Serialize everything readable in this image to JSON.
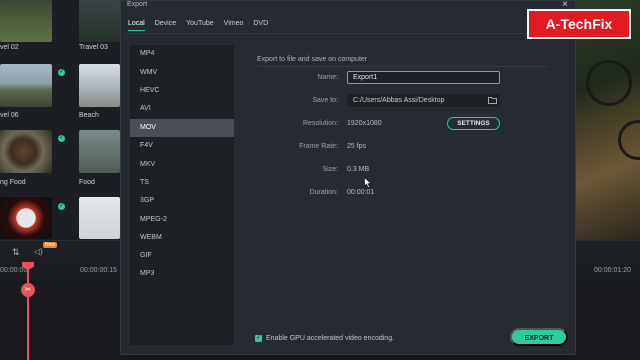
{
  "dialog": {
    "title": "Export",
    "close_glyph": "×",
    "tabs": [
      {
        "label": "Local",
        "active": true
      },
      {
        "label": "Device",
        "active": false
      },
      {
        "label": "YouTube",
        "active": false
      },
      {
        "label": "Vimeo",
        "active": false
      },
      {
        "label": "DVD",
        "active": false
      }
    ],
    "formats": [
      {
        "label": "MP4",
        "selected": false
      },
      {
        "label": "WMV",
        "selected": false
      },
      {
        "label": "HEVC",
        "selected": false
      },
      {
        "label": "AVI",
        "selected": false
      },
      {
        "label": "MOV",
        "selected": true
      },
      {
        "label": "F4V",
        "selected": false
      },
      {
        "label": "MKV",
        "selected": false
      },
      {
        "label": "TS",
        "selected": false
      },
      {
        "label": "3GP",
        "selected": false
      },
      {
        "label": "MPEG-2",
        "selected": false
      },
      {
        "label": "WEBM",
        "selected": false
      },
      {
        "label": "GIF",
        "selected": false
      },
      {
        "label": "MP3",
        "selected": false
      }
    ],
    "section_title": "Export to file and save on computer",
    "fields": {
      "name_label": "Name:",
      "name_value": "Export1",
      "save_label": "Save to:",
      "save_value": "C:/Users/Abbas Assi/Desktop",
      "resolution_label": "Resolution:",
      "resolution_value": "1920x1080",
      "framerate_label": "Frame Rate:",
      "framerate_value": "25 fps",
      "size_label": "Size:",
      "size_value": "0.3 MB",
      "duration_label": "Duration:",
      "duration_value": "00:00:01"
    },
    "settings_button": "SETTINGS",
    "gpu_checkbox": {
      "label": "Enable GPU accelerated video encoding.",
      "checked": true
    },
    "export_button": "EXPORT"
  },
  "media_library": {
    "items": [
      {
        "label": "vel 02"
      },
      {
        "label": "Travel 03"
      },
      {
        "label": "vel 06"
      },
      {
        "label": "Beach"
      },
      {
        "label": "ng Food"
      },
      {
        "label": "Food"
      }
    ]
  },
  "timeline": {
    "ticks": [
      "00:00:00",
      "00:00:00:15",
      "00:00:01:20"
    ],
    "badge": "New"
  },
  "watermark": {
    "text": "A-TechFix"
  },
  "colors": {
    "accent": "#2ecc9a",
    "dialog_bg": "#262a31",
    "list_bg": "#1d2025",
    "selected": "#4a4f57",
    "watermark": "#e21b23",
    "playhead": "#e8505b"
  }
}
